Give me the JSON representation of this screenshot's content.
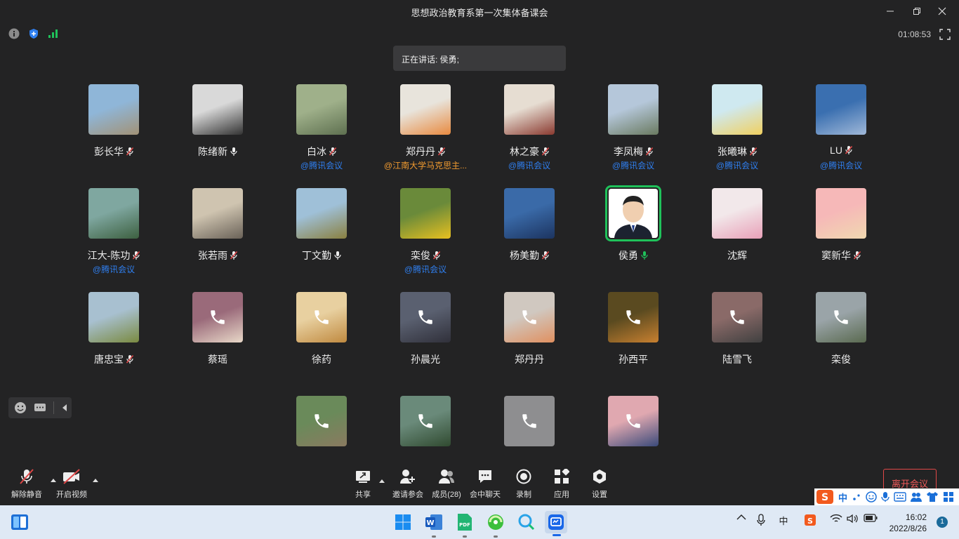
{
  "window": {
    "title": "思想政治教育系第一次集体备课会"
  },
  "meeting": {
    "timer": "01:08:53",
    "speaking_label": "正在讲话: 侯勇;"
  },
  "colors": {
    "accent_green": "#1fc15a",
    "leave_red": "#e04848",
    "link_blue": "#2f7ff0",
    "link_orange": "#f09a30"
  },
  "participants": [
    {
      "name": "彭长华",
      "mic": "muted",
      "source": "",
      "phone": false
    },
    {
      "name": "陈绪新",
      "mic": "on",
      "source": "",
      "phone": false
    },
    {
      "name": "白冰",
      "mic": "muted",
      "source": "@腾讯会议",
      "phone": false
    },
    {
      "name": "郑丹丹",
      "mic": "muted",
      "source": "@江南大学马克思主...",
      "source_color": "orange",
      "phone": false
    },
    {
      "name": "林之豪",
      "mic": "muted",
      "source": "@腾讯会议",
      "phone": false
    },
    {
      "name": "李凤梅",
      "mic": "muted",
      "source": "@腾讯会议",
      "phone": false
    },
    {
      "name": "张曦琳",
      "mic": "muted",
      "source": "@腾讯会议",
      "phone": false
    },
    {
      "name": "LU",
      "mic": "muted",
      "source": "@腾讯会议",
      "phone": false
    },
    {
      "name": "江大-陈功",
      "mic": "muted",
      "source": "@腾讯会议",
      "phone": false
    },
    {
      "name": "张若雨",
      "mic": "muted",
      "source": "",
      "phone": false
    },
    {
      "name": "丁文勤",
      "mic": "on",
      "source": "",
      "phone": false
    },
    {
      "name": "栾俊",
      "mic": "muted",
      "source": "@腾讯会议",
      "phone": false
    },
    {
      "name": "杨美勤",
      "mic": "muted",
      "source": "",
      "phone": false
    },
    {
      "name": "侯勇",
      "mic": "speaking",
      "source": "",
      "phone": false,
      "active": true
    },
    {
      "name": "沈辉",
      "mic": "none",
      "source": "",
      "phone": false
    },
    {
      "name": "窦新华",
      "mic": "muted",
      "source": "",
      "phone": false
    },
    {
      "name": "唐忠宝",
      "mic": "muted",
      "source": "",
      "phone": false
    },
    {
      "name": "蔡瑶",
      "mic": "none",
      "source": "",
      "phone": true
    },
    {
      "name": "徐药",
      "mic": "none",
      "source": "",
      "phone": true
    },
    {
      "name": "孙晨光",
      "mic": "none",
      "source": "",
      "phone": true
    },
    {
      "name": "郑丹丹",
      "mic": "none",
      "source": "",
      "phone": true
    },
    {
      "name": "孙西平",
      "mic": "none",
      "source": "",
      "phone": true
    },
    {
      "name": "陆雪飞",
      "mic": "none",
      "source": "",
      "phone": true
    },
    {
      "name": "栾俊",
      "mic": "none",
      "source": "",
      "phone": true
    },
    {
      "name": "",
      "mic": "none",
      "source": "",
      "phone": true
    },
    {
      "name": "",
      "mic": "none",
      "source": "",
      "phone": true
    },
    {
      "name": "",
      "mic": "none",
      "source": "",
      "phone": true
    },
    {
      "name": "",
      "mic": "none",
      "source": "",
      "phone": true
    }
  ],
  "toolbar": {
    "unmute": "解除静音",
    "start_video": "开启视频",
    "share": "共享",
    "invite": "邀请参会",
    "members": "成员(28)",
    "chat": "会中聊天",
    "record": "录制",
    "apps": "应用",
    "settings": "设置",
    "leave": "离开会议"
  },
  "ime": {
    "mode": "中"
  },
  "taskbar": {
    "time": "16:02",
    "date": "2022/8/26",
    "notifications": "1",
    "ime_tray": "中"
  }
}
